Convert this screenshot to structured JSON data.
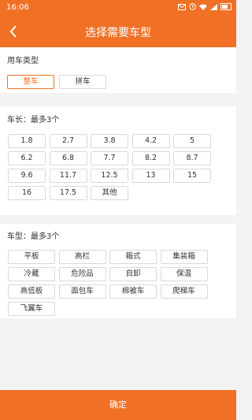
{
  "status_bar": {
    "time": "16:06",
    "icons": [
      "message-icon",
      "alarm-icon",
      "wifi-icon",
      "signal-icon",
      "battery-icon"
    ]
  },
  "header": {
    "title": "选择需要车型",
    "back_icon": "chevron-left-icon"
  },
  "vehicle_usage": {
    "label": "用车类型",
    "options": [
      {
        "label": "整车",
        "selected": true
      },
      {
        "label": "拼车",
        "selected": false
      }
    ]
  },
  "vehicle_length": {
    "label": "车长：最多3个",
    "options": [
      "1.8",
      "2.7",
      "3.8",
      "4.2",
      "5",
      "6.2",
      "6.8",
      "7.7",
      "8.2",
      "8.7",
      "9.6",
      "11.7",
      "12.5",
      "13",
      "15",
      "16",
      "17.5",
      "其他"
    ]
  },
  "vehicle_type": {
    "label": "车型：最多3个",
    "options": [
      "平板",
      "高栏",
      "箱式",
      "集装箱",
      "冷藏",
      "危险品",
      "自卸",
      "保温",
      "高低板",
      "面包车",
      "棉被车",
      "爬梯车",
      "飞翼车"
    ]
  },
  "footer": {
    "confirm_label": "确定"
  },
  "colors": {
    "accent": "#f07126",
    "background": "#f3f3f3",
    "chip_border": "#d9d9d9"
  }
}
